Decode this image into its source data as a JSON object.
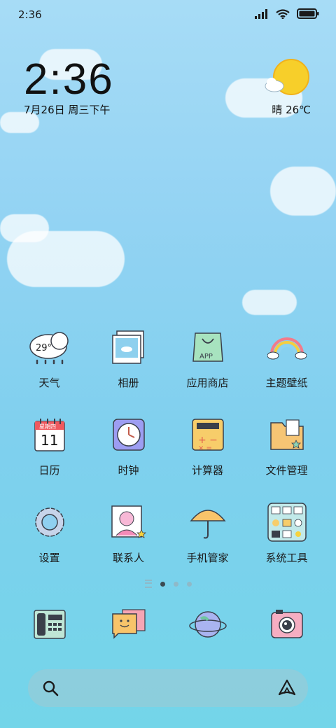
{
  "status_bar": {
    "time": "2:36",
    "icons": [
      "signal-icon",
      "wifi-icon",
      "battery-icon"
    ]
  },
  "clock_widget": {
    "time": "2:36",
    "date": "7月26日 周三下午"
  },
  "weather_widget": {
    "condition": "晴",
    "temperature": "26℃",
    "icon": "sun-cloud-icon"
  },
  "apps": [
    {
      "label": "天气",
      "icon": "weather-icon",
      "badge": "29°"
    },
    {
      "label": "相册",
      "icon": "gallery-icon"
    },
    {
      "label": "应用商店",
      "icon": "app-store-icon",
      "badge": "APP"
    },
    {
      "label": "主题壁纸",
      "icon": "rainbow-icon"
    },
    {
      "label": "日历",
      "icon": "calendar-icon",
      "badge": "星期四",
      "day": "11"
    },
    {
      "label": "时钟",
      "icon": "clock-icon"
    },
    {
      "label": "计算器",
      "icon": "calculator-icon"
    },
    {
      "label": "文件管理",
      "icon": "folder-icon"
    },
    {
      "label": "设置",
      "icon": "gear-icon"
    },
    {
      "label": "联系人",
      "icon": "contacts-icon"
    },
    {
      "label": "手机管家",
      "icon": "umbrella-icon"
    },
    {
      "label": "系统工具",
      "icon": "tools-folder-icon"
    }
  ],
  "page_indicator": {
    "pages": 3,
    "current": 1
  },
  "dock": [
    {
      "icon": "phone-icon"
    },
    {
      "icon": "messages-icon"
    },
    {
      "icon": "browser-planet-icon"
    },
    {
      "icon": "camera-icon"
    }
  ],
  "search_bar": {
    "icon": "search-icon",
    "right_icon": "assistant-icon"
  }
}
